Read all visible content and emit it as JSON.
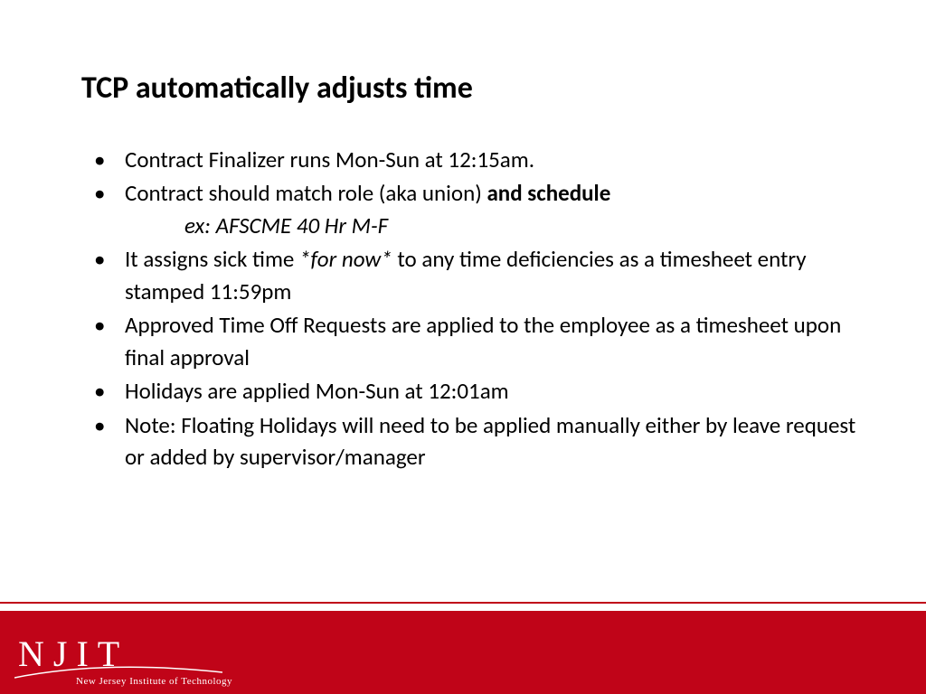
{
  "title": "TCP automatically adjusts time",
  "bullets": {
    "b0": "Contract Finalizer runs Mon-Sun at 12:15am.",
    "b1_a": "Contract should match role (aka union) ",
    "b1_b": "and schedule",
    "b1_sub": "ex:  AFSCME 40 Hr M-F",
    "b2_a": "It assigns sick time ",
    "b2_b": "*for now*",
    "b2_c": " to any time deficiencies as a timesheet entry stamped 11:59pm",
    "b3": "Approved Time Off Requests are applied to the employee as a timesheet upon final approval",
    "b4": "Holidays are applied Mon-Sun at 12:01am",
    "b5": "Note:  Floating Holidays will need to be applied manually either by leave request or added by supervisor/manager"
  },
  "footer": {
    "logo_letters": "NJIT",
    "logo_full": "New Jersey Institute of Technology"
  }
}
